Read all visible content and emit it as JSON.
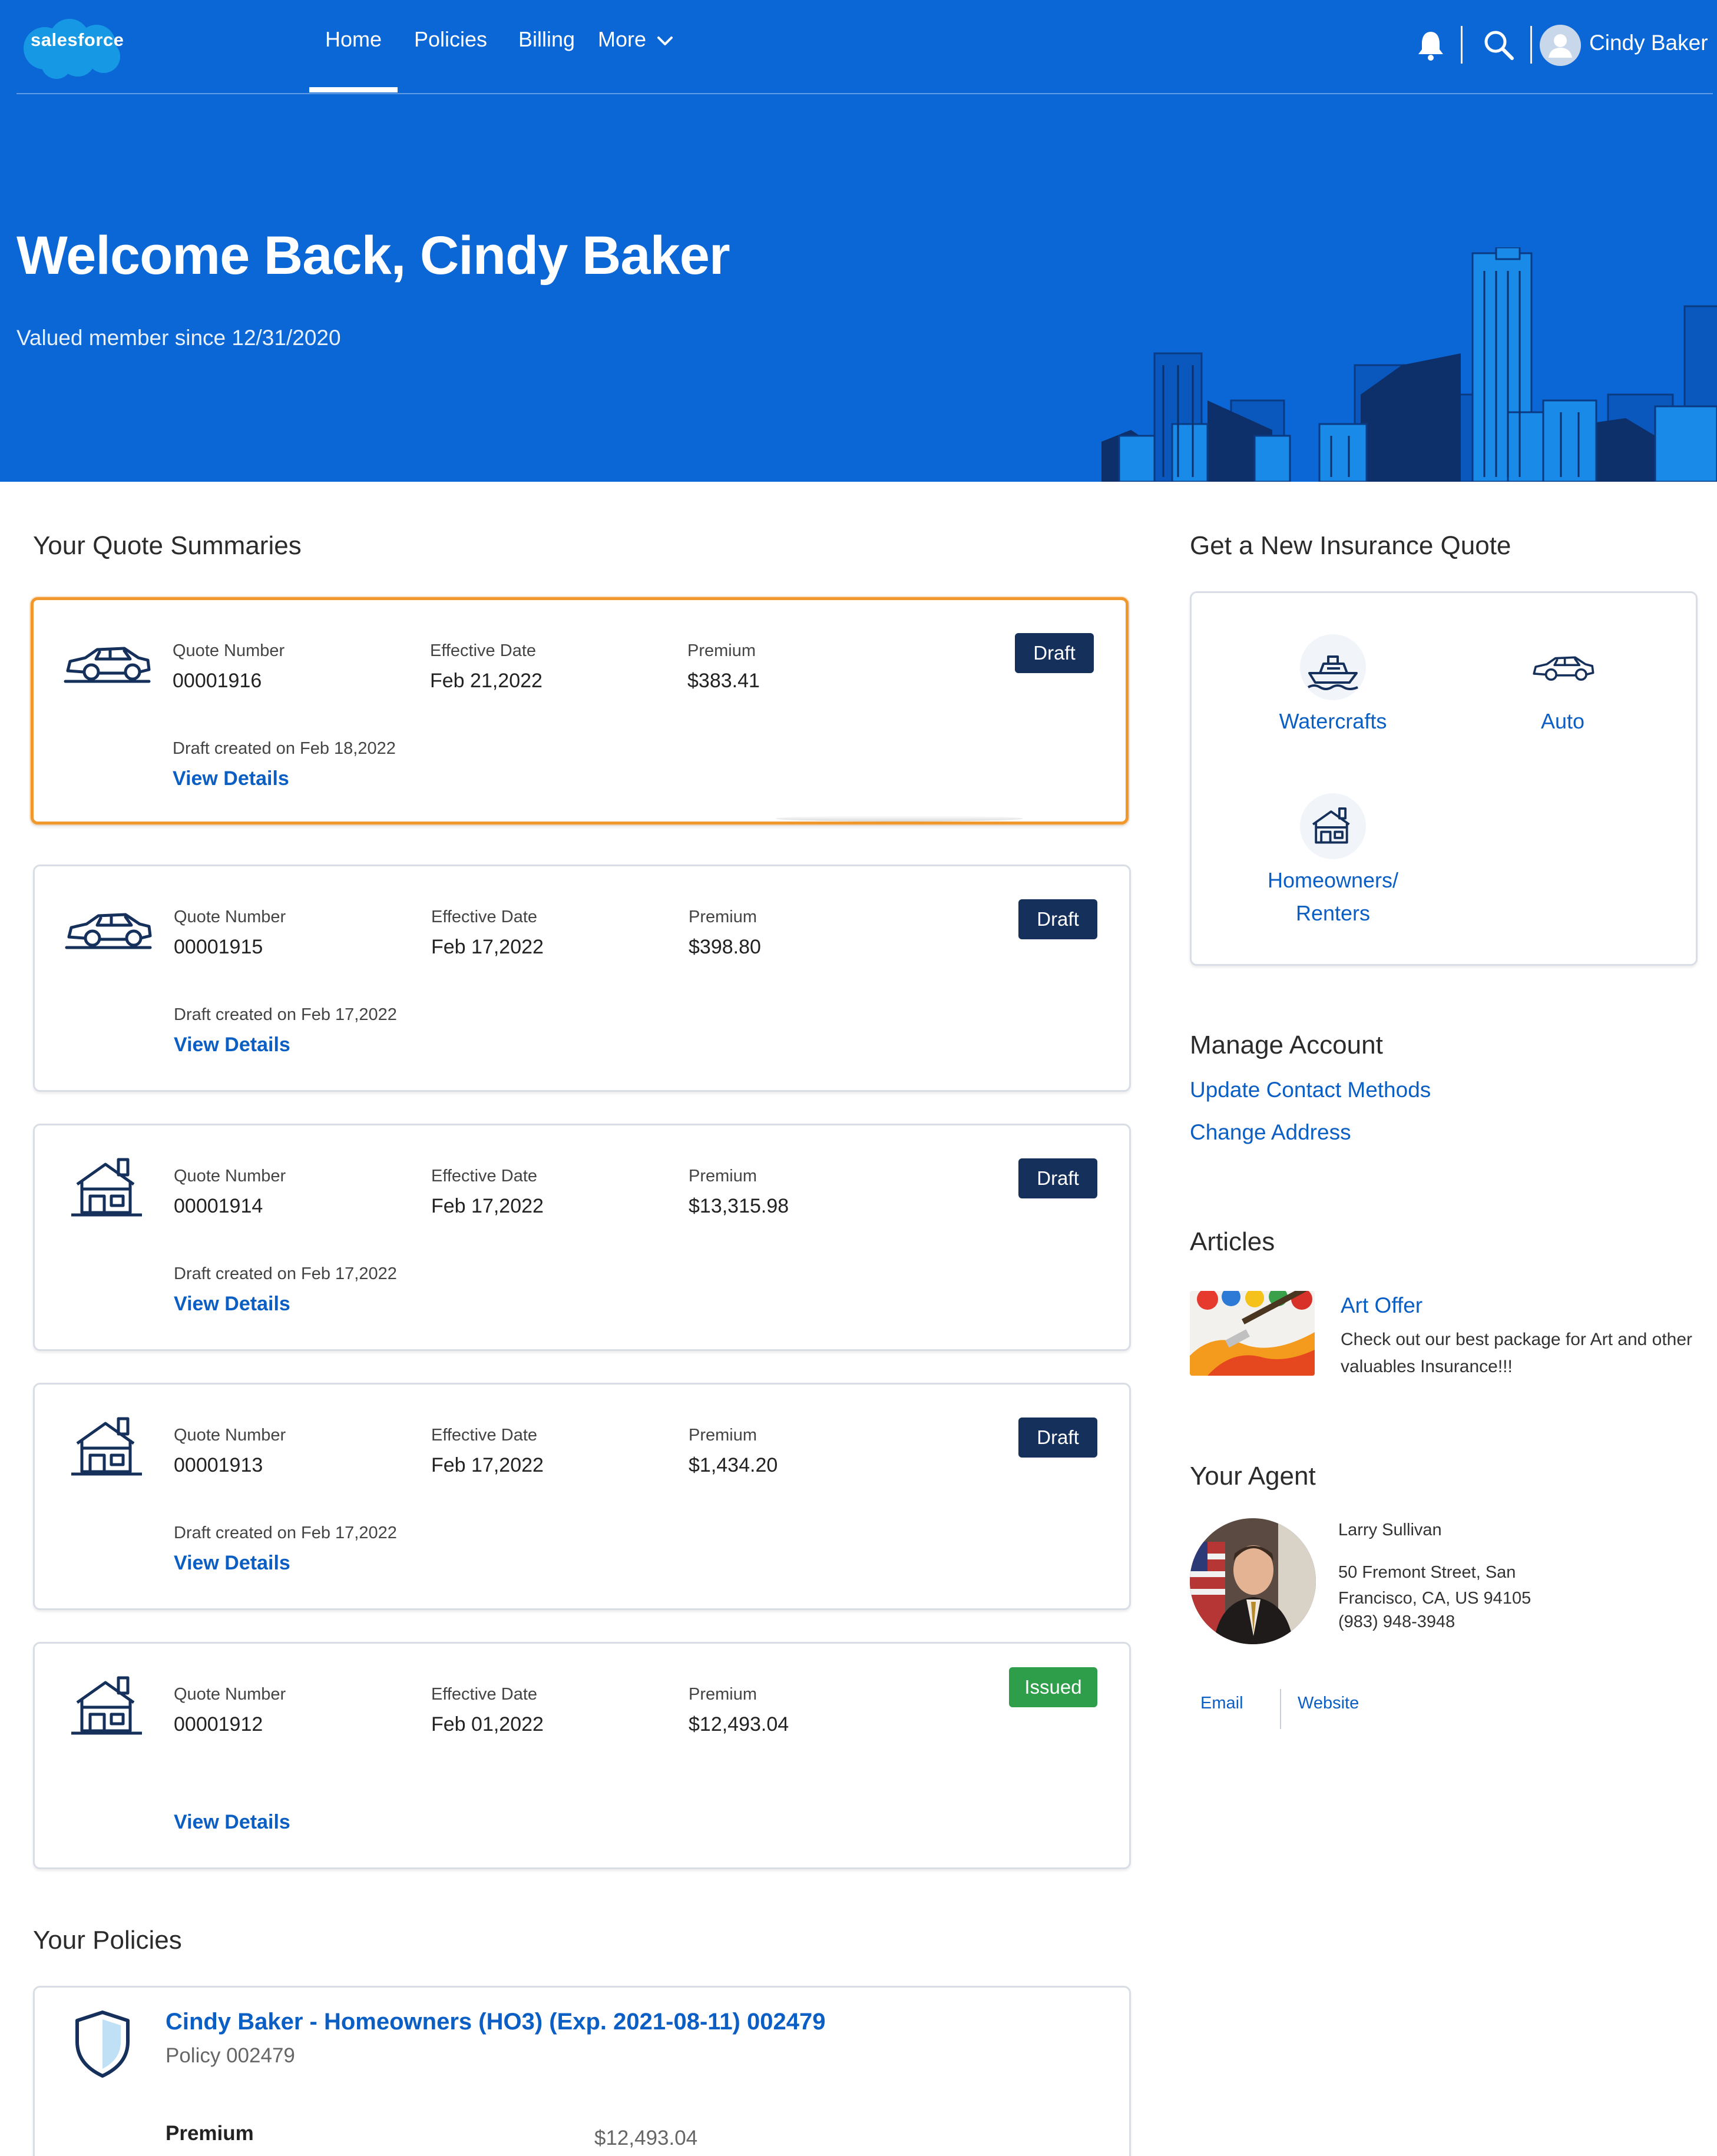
{
  "brand": {
    "logo_text": "salesforce"
  },
  "nav": {
    "items": [
      {
        "label": "Home"
      },
      {
        "label": "Policies"
      },
      {
        "label": "Billing"
      },
      {
        "label": "More"
      }
    ],
    "active": "Home",
    "user_name": "Cindy Baker"
  },
  "hero": {
    "title": "Welcome Back, Cindy Baker",
    "subtitle": "Valued member since 12/31/2020"
  },
  "quotes": {
    "heading": "Your Quote Summaries",
    "labels": {
      "number": "Quote Number",
      "effective": "Effective Date",
      "premium": "Premium",
      "view": "View Details"
    },
    "items": [
      {
        "icon": "car-icon",
        "number": "00001916",
        "effective": "Feb 21,2022",
        "premium": "$383.41",
        "status": "Draft",
        "created": "Draft created on Feb 18,2022"
      },
      {
        "icon": "car-icon",
        "number": "00001915",
        "effective": "Feb 17,2022",
        "premium": "$398.80",
        "status": "Draft",
        "created": "Draft created on Feb 17,2022"
      },
      {
        "icon": "house-icon",
        "number": "00001914",
        "effective": "Feb 17,2022",
        "premium": "$13,315.98",
        "status": "Draft",
        "created": "Draft created on Feb 17,2022"
      },
      {
        "icon": "house-icon",
        "number": "00001913",
        "effective": "Feb 17,2022",
        "premium": "$1,434.20",
        "status": "Draft",
        "created": "Draft created on Feb 17,2022"
      },
      {
        "icon": "house-icon",
        "number": "00001912",
        "effective": "Feb 01,2022",
        "premium": "$12,493.04",
        "status": "Issued",
        "created": ""
      }
    ]
  },
  "new_quote": {
    "heading": "Get a New Insurance Quote",
    "watercrafts": "Watercrafts",
    "auto": "Auto",
    "home_line1": "Homeowners/",
    "home_line2": "Renters"
  },
  "manage": {
    "heading": "Manage Account",
    "update_contact": "Update Contact Methods",
    "change_address": "Change Address"
  },
  "articles": {
    "heading": "Articles",
    "title": "Art Offer",
    "description": "Check out our best package for Art and other valuables Insurance!!!"
  },
  "agent": {
    "heading": "Your Agent",
    "name": "Larry Sullivan",
    "address": "50 Fremont Street, San Francisco, CA, US 94105",
    "phone": "(983) 948-3948",
    "email_label": "Email",
    "website_label": "Website"
  },
  "policies": {
    "heading": "Your Policies",
    "title": "Cindy Baker - Homeowners (HO3) (Exp. 2021-08-11) 002479",
    "subtitle": "Policy 002479",
    "premium_label": "Premium",
    "premium_value": "$12,493.04"
  },
  "colors": {
    "hero_blue": "#0b66d6",
    "link_blue": "#0a5ec4",
    "draft_badge": "#16305c",
    "issued_badge": "#2f9e4b",
    "focus_ring": "#f0982e"
  }
}
